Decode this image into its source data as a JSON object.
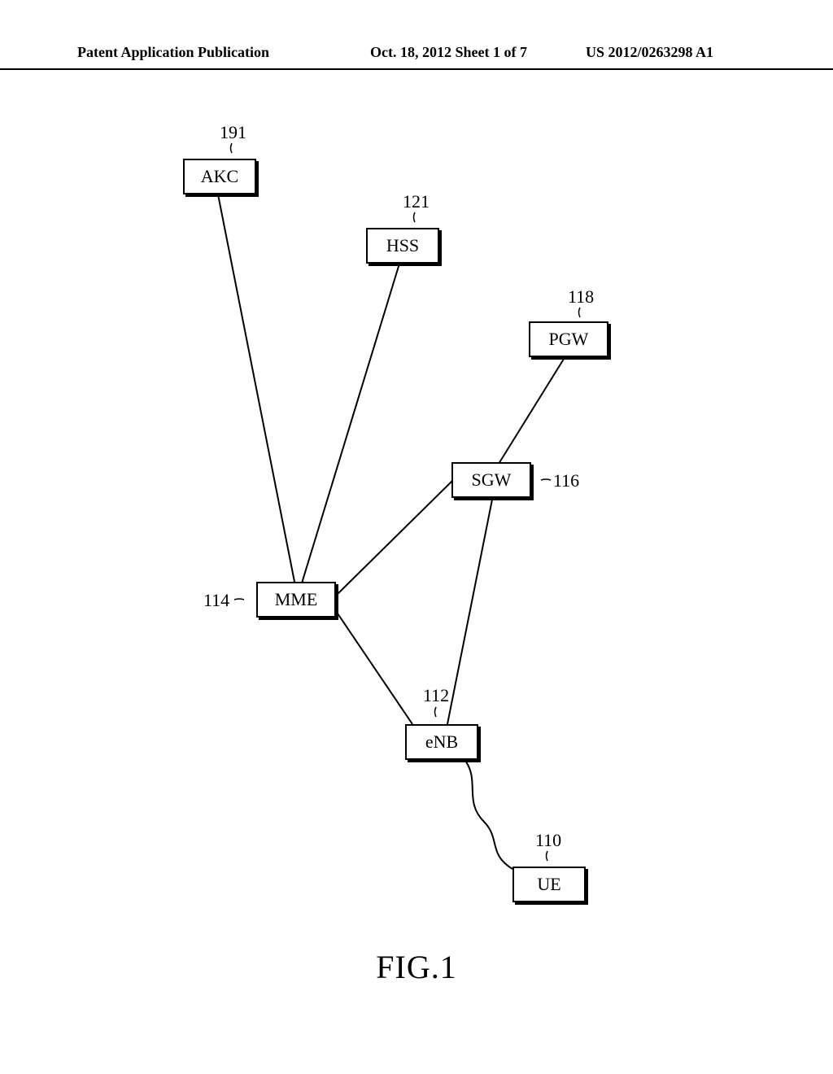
{
  "header": {
    "left": "Patent Application Publication",
    "center": "Oct. 18, 2012  Sheet 1 of 7",
    "right": "US 2012/0263298 A1"
  },
  "nodes": {
    "akc": {
      "label": "AKC",
      "ref": "191"
    },
    "hss": {
      "label": "HSS",
      "ref": "121"
    },
    "pgw": {
      "label": "PGW",
      "ref": "118"
    },
    "sgw": {
      "label": "SGW",
      "ref": "116"
    },
    "mme": {
      "label": "MME",
      "ref": "114"
    },
    "enb": {
      "label": "eNB",
      "ref": "112"
    },
    "ue": {
      "label": "UE",
      "ref": "110"
    }
  },
  "figure_caption": "FIG.1"
}
